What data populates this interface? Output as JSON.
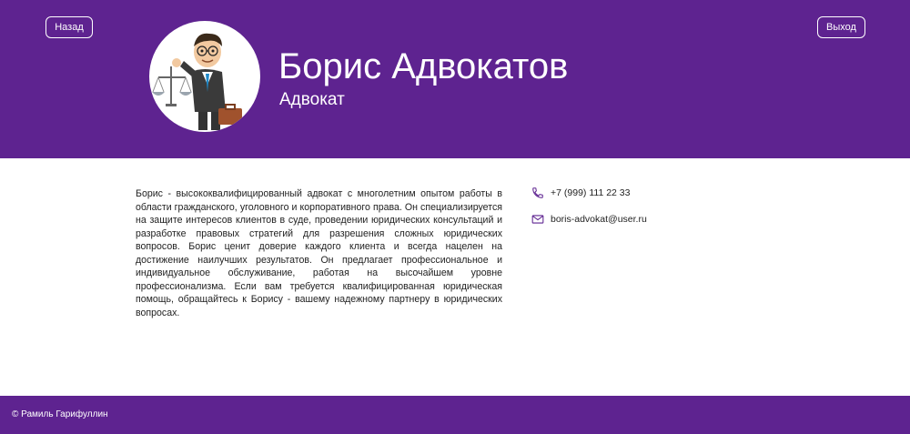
{
  "header": {
    "back_label": "Назад",
    "exit_label": "Выход",
    "name": "Борис Адвокатов",
    "role": "Адвокат"
  },
  "bio": "Борис - высококвалифицированный адвокат с многолетним опытом работы в области гражданского, уголовного и корпоративного права. Он специализируется на защите интересов клиентов в суде, проведении юридических консультаций и разработке правовых стратегий для разрешения сложных юридических вопросов. Борис ценит доверие каждого клиента и всегда нацелен на достижение наилучших результатов. Он предлагает профессиональное и индивидуальное обслуживание, работая на высочайшем уровне профессионализма. Если вам требуется квалифицированная юридическая помощь, обращайтесь к Борису - вашему надежному партнеру в юридических вопросах.",
  "contacts": {
    "phone": "+7 (999) 111 22 33",
    "email": "boris-advokat@user.ru"
  },
  "footer": {
    "copyright": "© Рамиль Гарифуллин"
  },
  "colors": {
    "brand": "#5e2390",
    "text": "#222222"
  },
  "icons": [
    "phone-icon",
    "mail-icon"
  ]
}
